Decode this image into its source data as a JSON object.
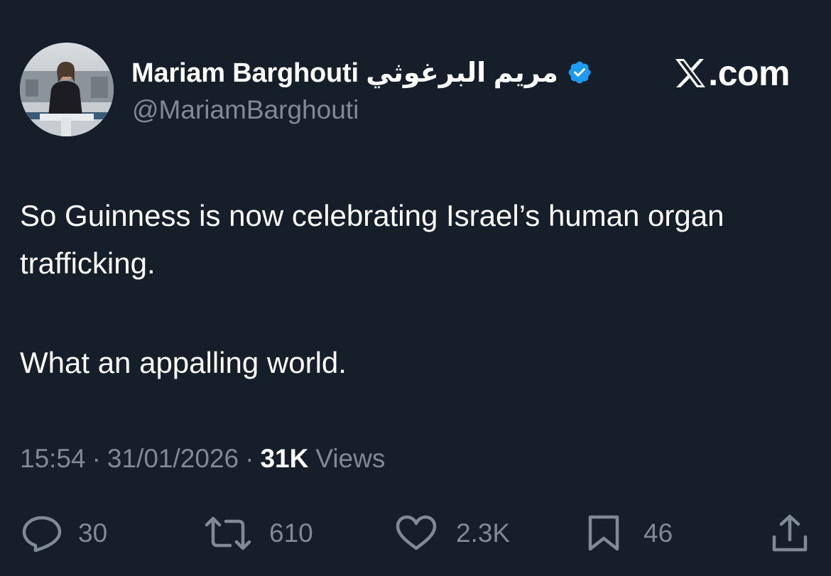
{
  "author": {
    "display_name": "Mariam Barghouti مريم البرغوثي",
    "handle": "@MariamBarghouti",
    "verified_icon": "verified-badge-icon",
    "avatar": "avatar-photo"
  },
  "brand": {
    "logo_icon": "x-logo-icon",
    "text": ".com"
  },
  "tweet": {
    "paragraphs": [
      "So Guinness is now celebrating Israel’s human organ trafficking.",
      "What an appalling world."
    ]
  },
  "meta": {
    "time": "15:54",
    "separator": "·",
    "date": "31/01/2026",
    "views_count": "31K",
    "views_label": "Views"
  },
  "actions": {
    "replies": {
      "icon": "reply-icon",
      "count": "30"
    },
    "reposts": {
      "icon": "repost-icon",
      "count": "610"
    },
    "likes": {
      "icon": "heart-icon",
      "count": "2.3K"
    },
    "bookmarks": {
      "icon": "bookmark-icon",
      "count": "46"
    },
    "share": {
      "icon": "share-icon"
    }
  },
  "colors": {
    "background": "#161e29",
    "text_primary": "#ffffff",
    "text_secondary": "#7f8a96",
    "verified_blue": "#1d9bf0"
  }
}
